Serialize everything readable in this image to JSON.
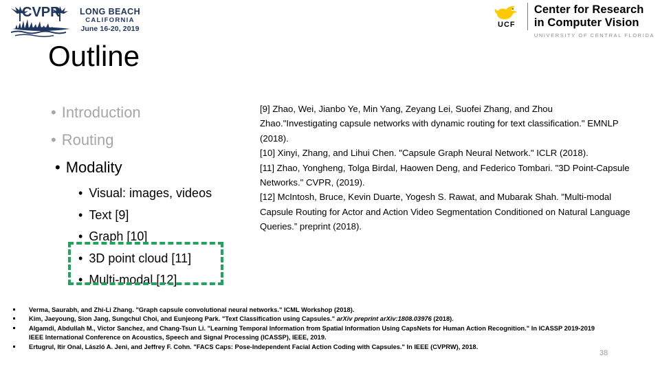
{
  "logos": {
    "cvpr": {
      "name": "cvpr-logo",
      "line1": "LONG BEACH",
      "line2": "CALIFORNIA",
      "line3": "June 16-20, 2019",
      "color": "#21365F"
    },
    "crcv": {
      "name": "ucf-crcv-logo",
      "ucf_word": "UCF",
      "title_line1": "Center for Research",
      "title_line2": "in Computer Vision",
      "subtitle": "UNIVERSITY OF CENTRAL FLORIDA",
      "gold": "#FFC904",
      "subtitle_color": "#8d8d8d"
    }
  },
  "title": "Outline",
  "outline": {
    "bullet_glyph": "•",
    "level1": [
      {
        "label": "Introduction",
        "state": "dim"
      },
      {
        "label": "Routing",
        "state": "dim"
      },
      {
        "label": "Modality",
        "state": "active"
      }
    ],
    "level2": [
      {
        "label": "Visual: images, videos"
      },
      {
        "label": "Text [9]"
      },
      {
        "label": "Graph [10]"
      },
      {
        "label": "3D point cloud [11]"
      },
      {
        "label": "Multi-modal [12]"
      }
    ],
    "dim_color": "#A6A6A6",
    "highlight_color": "#22A45E"
  },
  "references": [
    "[9] Zhao, Wei, Jianbo Ye, Min Yang, Zeyang Lei, Suofei Zhang, and Zhou Zhao.\"Investigating capsule networks with dynamic routing for text classification.\" EMNLP (2018).",
    "[10] Xinyi, Zhang, and Lihui Chen. \"Capsule Graph Neural Network.\" ICLR (2018).",
    "[11] Zhao, Yongheng, Tolga Birdal, Haowen Deng, and Federico Tombari. \"3D Point-Capsule Networks.\" CVPR,  (2019).",
    "[12] McIntosh, Bruce, Kevin Duarte, Yogesh S. Rawat, and Mubarak Shah. \"Multi-modal Capsule Routing for Actor and Action Video Segmentation Conditioned on Natural Language Queries.” preprint (2018)."
  ],
  "footnotes": [
    {
      "text_before": "Verma, Saurabh, and Zhi-Li Zhang. \"Graph capsule convolutional neural networks.\" ICML Workshop  (2018).",
      "italic": "",
      "text_after": ""
    },
    {
      "text_before": "Kim, Jaeyoung, Sion Jang, Sungchul Choi, and Eunjeong Park. \"Text Classification using Capsules.\" ",
      "italic": "arXiv preprint arXiv:1808.03976",
      "text_after": " (2018)."
    },
    {
      "text_before": "Algamdi, Abdullah M., Victor Sanchez, and Chang-Tsun Li. \"Learning Temporal Information from Spatial Information Using CapsNets for Human Action Recognition.\" In ICASSP 2019-2019 IEEE International Conference on Acoustics, Speech and Signal Processing (ICASSP), IEEE, 2019.",
      "italic": "",
      "text_after": ""
    },
    {
      "text_before": "Ertugrul, Itir Onal, László A. Jeni, and Jeffrey F. Cohn. \"FACS Caps: Pose-Independent Facial Action Coding with Capsules.\" In IEEE (CVPRW), 2018.",
      "italic": "",
      "text_after": ""
    }
  ],
  "slide_number": "38"
}
